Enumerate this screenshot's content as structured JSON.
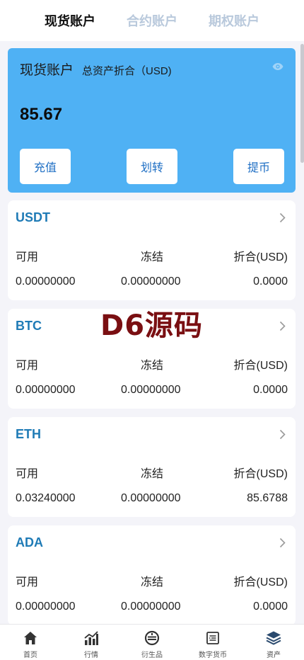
{
  "tabs": {
    "items": [
      {
        "label": "现货账户",
        "active": true
      },
      {
        "label": "合约账户",
        "active": false
      },
      {
        "label": "期权账户",
        "active": false
      }
    ]
  },
  "summary": {
    "title": "现货账户",
    "subtitle": "总资产折合（USD)",
    "total": "85.67",
    "deposit_label": "充值",
    "transfer_label": "划转",
    "withdraw_label": "提币"
  },
  "assets": [
    {
      "name": "USDT",
      "available_label": "可用",
      "frozen_label": "冻结",
      "converted_label": "折合(USD)",
      "available": "0.00000000",
      "frozen": "0.00000000",
      "converted": "0.0000"
    },
    {
      "name": "BTC",
      "available_label": "可用",
      "frozen_label": "冻结",
      "converted_label": "折合(USD)",
      "available": "0.00000000",
      "frozen": "0.00000000",
      "converted": "0.0000"
    },
    {
      "name": "ETH",
      "available_label": "可用",
      "frozen_label": "冻结",
      "converted_label": "折合(USD)",
      "available": "0.03240000",
      "frozen": "0.00000000",
      "converted": "85.6788"
    },
    {
      "name": "ADA",
      "available_label": "可用",
      "frozen_label": "冻结",
      "converted_label": "折合(USD)",
      "available": "0.00000000",
      "frozen": "0.00000000",
      "converted": "0.0000"
    }
  ],
  "watermark": "D6源码",
  "bottom_nav": [
    {
      "label": "首页",
      "icon": "home-icon"
    },
    {
      "label": "行情",
      "icon": "market-chart-icon"
    },
    {
      "label": "衍生品",
      "icon": "derivatives-icon"
    },
    {
      "label": "数字货币",
      "icon": "digital-currency-icon"
    },
    {
      "label": "资产",
      "icon": "assets-layers-icon",
      "active": true
    }
  ],
  "colors": {
    "accent": "#4fb1f4",
    "coin_name": "#1f7bb6",
    "button_text": "#1f6fc4",
    "watermark": "#7a0f12",
    "active_nav_icon": "#2a4a6e"
  }
}
